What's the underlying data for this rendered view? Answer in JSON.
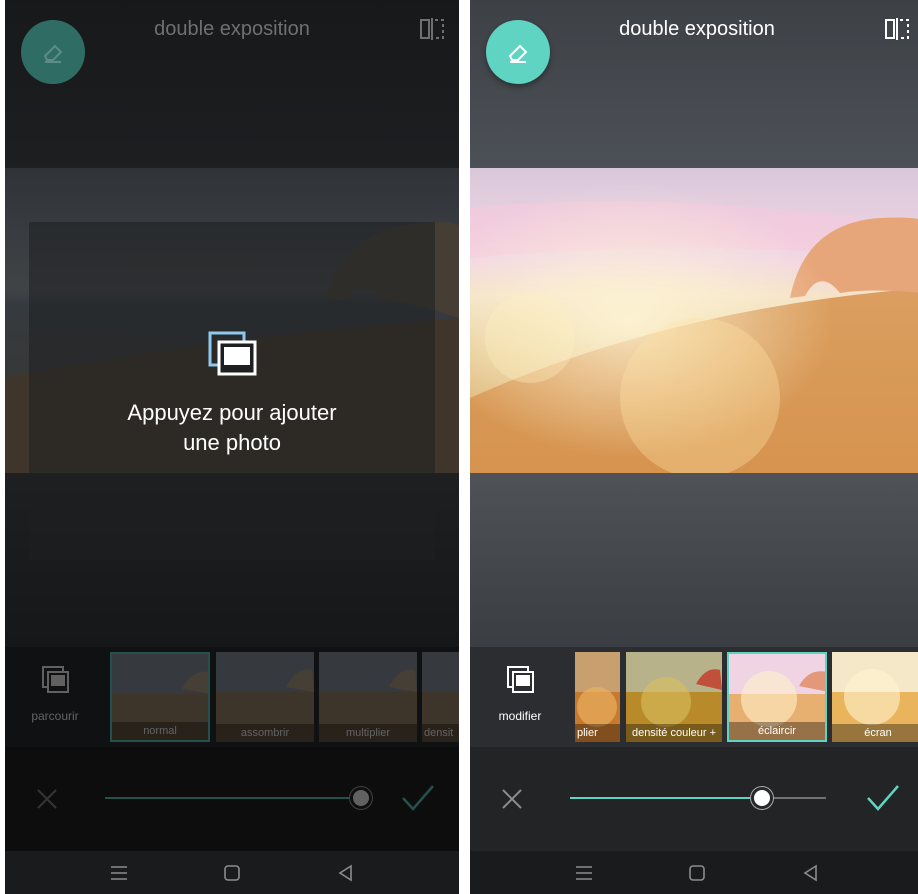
{
  "left_screen": {
    "title": "double exposition",
    "browse_label": "parcourir",
    "add_photo_text_line1": "Appuyez pour ajouter",
    "add_photo_text_line2": "une photo",
    "thumbnails": [
      {
        "label": "normal",
        "selected": true
      },
      {
        "label": "assombrir",
        "selected": false
      },
      {
        "label": "multiplier",
        "selected": false
      },
      {
        "label": "densit",
        "selected": false
      }
    ],
    "slider_value": 1.0
  },
  "right_screen": {
    "title": "double exposition",
    "browse_label": "modifier",
    "thumbnails": [
      {
        "label": "plier",
        "selected": false
      },
      {
        "label": "densité couleur +",
        "selected": false
      },
      {
        "label": "éclaircir",
        "selected": true
      },
      {
        "label": "écran",
        "selected": false
      }
    ],
    "slider_value": 0.75
  },
  "colors": {
    "accent": "#5fd4c2",
    "toolbar_dark": "#222426",
    "strip_bg": "#2b2d30"
  },
  "icons": {
    "fab": "eraser-icon",
    "compare": "compare-split-icon",
    "browse": "photos-stack-icon",
    "cancel": "close-icon",
    "confirm": "checkmark-icon",
    "nav": [
      "menu-icon",
      "home-icon",
      "back-icon"
    ]
  }
}
